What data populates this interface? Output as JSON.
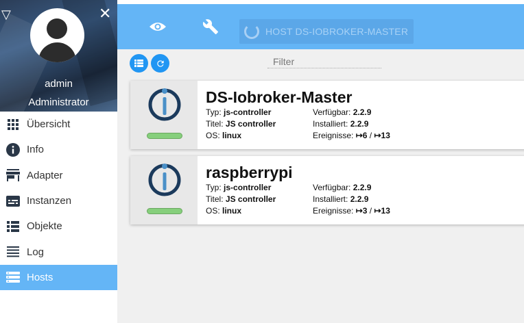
{
  "sidebar": {
    "user": {
      "name": "admin",
      "role": "Administrator"
    },
    "items": [
      {
        "label": "Übersicht",
        "icon": "grid-icon",
        "active": false
      },
      {
        "label": "Info",
        "icon": "info-icon",
        "active": false
      },
      {
        "label": "Adapter",
        "icon": "store-icon",
        "active": false
      },
      {
        "label": "Instanzen",
        "icon": "instances-icon",
        "active": false
      },
      {
        "label": "Objekte",
        "icon": "list-icon",
        "active": false
      },
      {
        "label": "Log",
        "icon": "lines-icon",
        "active": false
      },
      {
        "label": "Hosts",
        "icon": "hosts-icon",
        "active": true
      }
    ]
  },
  "topbar": {
    "host_select": "HOST DS-IOBROKER-MASTER"
  },
  "filter": {
    "placeholder": "Filter"
  },
  "hosts": [
    {
      "name": "DS-Iobroker-Master",
      "typ_label": "Typ:",
      "typ": "js-controller",
      "titel_label": "Titel:",
      "titel": "JS controller",
      "os_label": "OS:",
      "os": "linux",
      "verf_label": "Verfügbar:",
      "verf": "2.2.9",
      "inst_label": "Installiert:",
      "inst": "2.2.9",
      "ereig_label": "Ereignisse:",
      "ereig_in": "↦6",
      "ereig_sep": " / ",
      "ereig_out": "↦13"
    },
    {
      "name": "raspberrypi",
      "typ_label": "Typ:",
      "typ": "js-controller",
      "titel_label": "Titel:",
      "titel": "JS controller",
      "os_label": "OS:",
      "os": "linux",
      "verf_label": "Verfügbar:",
      "verf": "2.2.9",
      "inst_label": "Installiert:",
      "inst": "2.2.9",
      "ereig_label": "Ereignisse:",
      "ereig_in": "↦3",
      "ereig_sep": " / ",
      "ereig_out": "↦13"
    }
  ],
  "colors": {
    "accent": "#64b5f6",
    "button": "#2196f3",
    "status_ok": "#86cf7c"
  }
}
